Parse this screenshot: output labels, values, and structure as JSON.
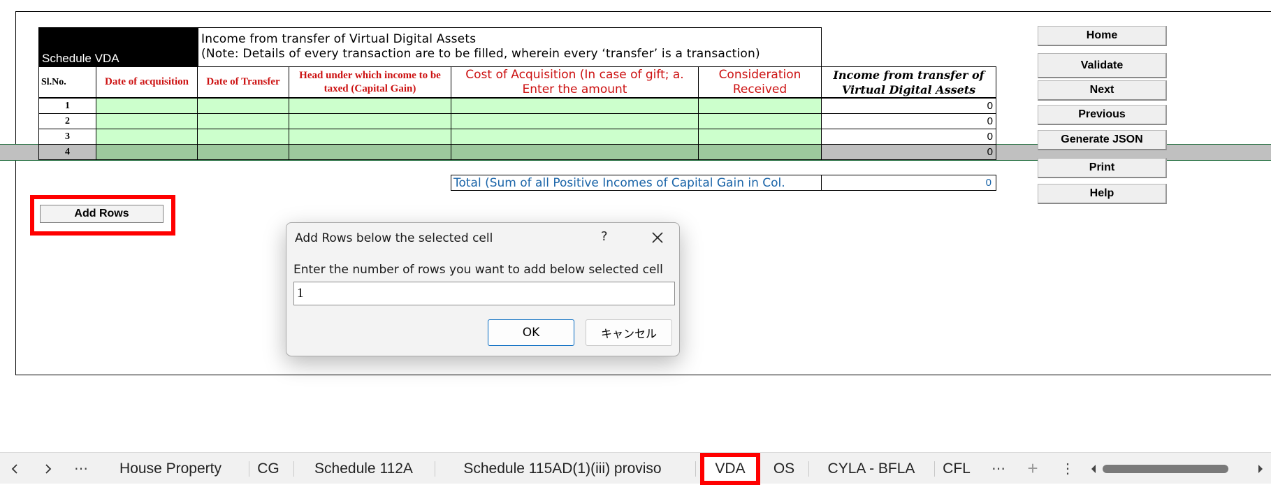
{
  "schedule": {
    "heading": "Schedule VDA",
    "title_line1": "Income from transfer of Virtual Digital Assets",
    "title_line2": "(Note: Details of every transaction are to be filled, wherein every ‘transfer’ is a transaction)",
    "columns": {
      "slno": "Sl.No.",
      "date_acq": "Date of acquisition",
      "date_transfer": "Date of Transfer",
      "head": "Head under which income to be taxed (Capital Gain)",
      "cost": "Cost of Acquisition (In case of gift; a. Enter the amount",
      "consideration": "Consideration Received",
      "income": "Income from transfer of Virtual Digital Assets"
    },
    "rows": [
      {
        "no": "1",
        "income": "0"
      },
      {
        "no": "2",
        "income": "0"
      },
      {
        "no": "3",
        "income": "0"
      },
      {
        "no": "4",
        "income": "0"
      }
    ],
    "total_label": "Total (Sum of all Positive Incomes of Capital Gain in Col.",
    "total_value": "0"
  },
  "nav_buttons": [
    "Home",
    "Validate",
    "Next",
    "Previous",
    "Generate JSON",
    "Print",
    "Help"
  ],
  "add_rows_label": "Add Rows",
  "dialog": {
    "title": "Add Rows below the selected cell",
    "help": "?",
    "prompt": "Enter the number of rows you want to add below selected cell",
    "input_value": "1",
    "ok": "OK",
    "cancel": "キャンセル"
  },
  "tabs": {
    "items": [
      "House Property",
      "CG",
      "Schedule 112A",
      "Schedule 115AD(1)(iii) proviso",
      "VDA",
      "OS",
      "CYLA - BFLA",
      "CFL"
    ],
    "active": "VDA",
    "more": "⋯",
    "add": "+",
    "options": "⋮"
  },
  "highlight_color": "#ff0000",
  "green_cell_color": "#ccffcc"
}
